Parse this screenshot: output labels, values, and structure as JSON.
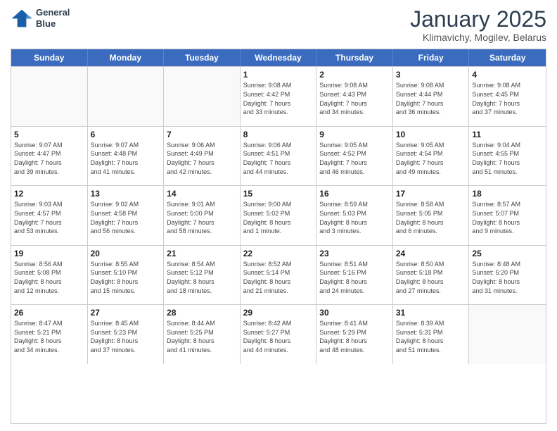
{
  "header": {
    "logo_line1": "General",
    "logo_line2": "Blue",
    "month": "January 2025",
    "location": "Klimavichy, Mogilev, Belarus"
  },
  "days_of_week": [
    "Sunday",
    "Monday",
    "Tuesday",
    "Wednesday",
    "Thursday",
    "Friday",
    "Saturday"
  ],
  "rows": [
    [
      {
        "day": "",
        "info": ""
      },
      {
        "day": "",
        "info": ""
      },
      {
        "day": "",
        "info": ""
      },
      {
        "day": "1",
        "info": "Sunrise: 9:08 AM\nSunset: 4:42 PM\nDaylight: 7 hours\nand 33 minutes."
      },
      {
        "day": "2",
        "info": "Sunrise: 9:08 AM\nSunset: 4:43 PM\nDaylight: 7 hours\nand 34 minutes."
      },
      {
        "day": "3",
        "info": "Sunrise: 9:08 AM\nSunset: 4:44 PM\nDaylight: 7 hours\nand 36 minutes."
      },
      {
        "day": "4",
        "info": "Sunrise: 9:08 AM\nSunset: 4:45 PM\nDaylight: 7 hours\nand 37 minutes."
      }
    ],
    [
      {
        "day": "5",
        "info": "Sunrise: 9:07 AM\nSunset: 4:47 PM\nDaylight: 7 hours\nand 39 minutes."
      },
      {
        "day": "6",
        "info": "Sunrise: 9:07 AM\nSunset: 4:48 PM\nDaylight: 7 hours\nand 41 minutes."
      },
      {
        "day": "7",
        "info": "Sunrise: 9:06 AM\nSunset: 4:49 PM\nDaylight: 7 hours\nand 42 minutes."
      },
      {
        "day": "8",
        "info": "Sunrise: 9:06 AM\nSunset: 4:51 PM\nDaylight: 7 hours\nand 44 minutes."
      },
      {
        "day": "9",
        "info": "Sunrise: 9:05 AM\nSunset: 4:52 PM\nDaylight: 7 hours\nand 46 minutes."
      },
      {
        "day": "10",
        "info": "Sunrise: 9:05 AM\nSunset: 4:54 PM\nDaylight: 7 hours\nand 49 minutes."
      },
      {
        "day": "11",
        "info": "Sunrise: 9:04 AM\nSunset: 4:55 PM\nDaylight: 7 hours\nand 51 minutes."
      }
    ],
    [
      {
        "day": "12",
        "info": "Sunrise: 9:03 AM\nSunset: 4:57 PM\nDaylight: 7 hours\nand 53 minutes."
      },
      {
        "day": "13",
        "info": "Sunrise: 9:02 AM\nSunset: 4:58 PM\nDaylight: 7 hours\nand 56 minutes."
      },
      {
        "day": "14",
        "info": "Sunrise: 9:01 AM\nSunset: 5:00 PM\nDaylight: 7 hours\nand 58 minutes."
      },
      {
        "day": "15",
        "info": "Sunrise: 9:00 AM\nSunset: 5:02 PM\nDaylight: 8 hours\nand 1 minute."
      },
      {
        "day": "16",
        "info": "Sunrise: 8:59 AM\nSunset: 5:03 PM\nDaylight: 8 hours\nand 3 minutes."
      },
      {
        "day": "17",
        "info": "Sunrise: 8:58 AM\nSunset: 5:05 PM\nDaylight: 8 hours\nand 6 minutes."
      },
      {
        "day": "18",
        "info": "Sunrise: 8:57 AM\nSunset: 5:07 PM\nDaylight: 8 hours\nand 9 minutes."
      }
    ],
    [
      {
        "day": "19",
        "info": "Sunrise: 8:56 AM\nSunset: 5:08 PM\nDaylight: 8 hours\nand 12 minutes."
      },
      {
        "day": "20",
        "info": "Sunrise: 8:55 AM\nSunset: 5:10 PM\nDaylight: 8 hours\nand 15 minutes."
      },
      {
        "day": "21",
        "info": "Sunrise: 8:54 AM\nSunset: 5:12 PM\nDaylight: 8 hours\nand 18 minutes."
      },
      {
        "day": "22",
        "info": "Sunrise: 8:52 AM\nSunset: 5:14 PM\nDaylight: 8 hours\nand 21 minutes."
      },
      {
        "day": "23",
        "info": "Sunrise: 8:51 AM\nSunset: 5:16 PM\nDaylight: 8 hours\nand 24 minutes."
      },
      {
        "day": "24",
        "info": "Sunrise: 8:50 AM\nSunset: 5:18 PM\nDaylight: 8 hours\nand 27 minutes."
      },
      {
        "day": "25",
        "info": "Sunrise: 8:48 AM\nSunset: 5:20 PM\nDaylight: 8 hours\nand 31 minutes."
      }
    ],
    [
      {
        "day": "26",
        "info": "Sunrise: 8:47 AM\nSunset: 5:21 PM\nDaylight: 8 hours\nand 34 minutes."
      },
      {
        "day": "27",
        "info": "Sunrise: 8:45 AM\nSunset: 5:23 PM\nDaylight: 8 hours\nand 37 minutes."
      },
      {
        "day": "28",
        "info": "Sunrise: 8:44 AM\nSunset: 5:25 PM\nDaylight: 8 hours\nand 41 minutes."
      },
      {
        "day": "29",
        "info": "Sunrise: 8:42 AM\nSunset: 5:27 PM\nDaylight: 8 hours\nand 44 minutes."
      },
      {
        "day": "30",
        "info": "Sunrise: 8:41 AM\nSunset: 5:29 PM\nDaylight: 8 hours\nand 48 minutes."
      },
      {
        "day": "31",
        "info": "Sunrise: 8:39 AM\nSunset: 5:31 PM\nDaylight: 8 hours\nand 51 minutes."
      },
      {
        "day": "",
        "info": ""
      }
    ]
  ]
}
